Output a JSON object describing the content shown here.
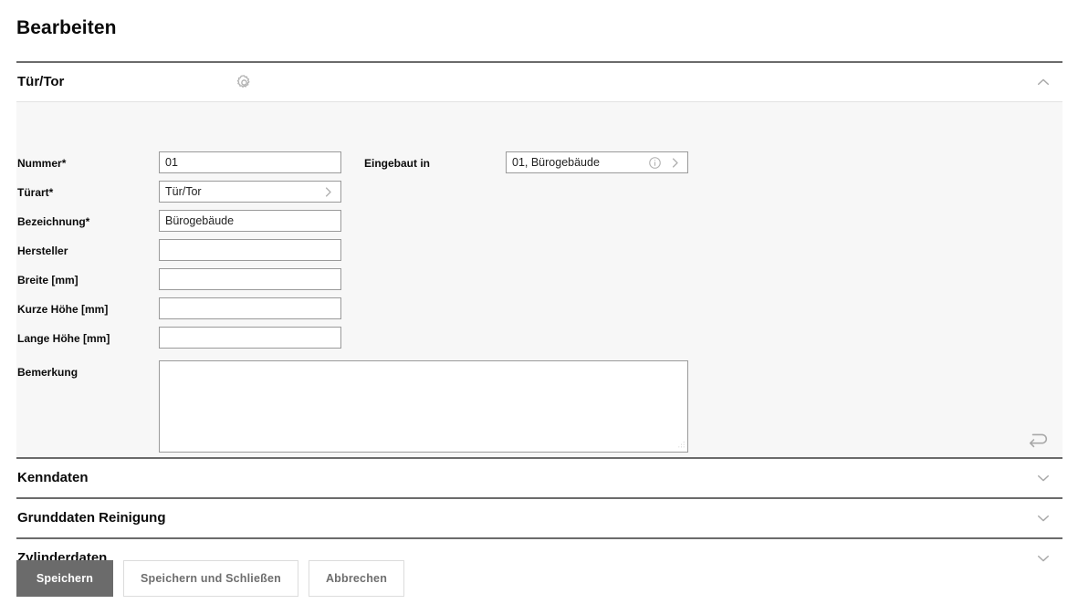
{
  "page": {
    "title": "Bearbeiten"
  },
  "sections": [
    {
      "title": "Tür/Tor",
      "expanded": true,
      "gear_icon": "gear-icon",
      "toggle_icon": "chevron-up-icon",
      "revert_icon": "undo-arrow-icon",
      "fields_left": [
        {
          "label": "Nummer",
          "required": true,
          "required_marker": "*",
          "value": "01",
          "placeholder": "",
          "type": "text",
          "trailing": []
        },
        {
          "label": "Türart",
          "required": true,
          "required_marker": "*",
          "value": "Tür/Tor",
          "placeholder": "",
          "type": "picker",
          "trailing": [
            "chevron-right-icon"
          ]
        },
        {
          "label": "Bezeichnung",
          "required": true,
          "required_marker": "*",
          "value": "Bürogebäude",
          "placeholder": "",
          "type": "text",
          "trailing": []
        },
        {
          "label": "Hersteller",
          "required": false,
          "required_marker": "",
          "value": "",
          "placeholder": "",
          "type": "text",
          "trailing": []
        },
        {
          "label": "Breite [mm]",
          "required": false,
          "required_marker": "",
          "value": "",
          "placeholder": "",
          "type": "text",
          "trailing": []
        },
        {
          "label": "Kurze Höhe [mm]",
          "required": false,
          "required_marker": "",
          "value": "",
          "placeholder": "",
          "type": "text",
          "trailing": []
        },
        {
          "label": "Lange Höhe [mm]",
          "required": false,
          "required_marker": "",
          "value": "",
          "placeholder": "",
          "type": "text",
          "trailing": []
        }
      ],
      "fields_right": [
        {
          "label": "Eingebaut in",
          "required": false,
          "required_marker": "",
          "value": "01, Bürogebäude",
          "placeholder": "",
          "type": "picker",
          "trailing": [
            "info-circle-icon",
            "chevron-right-icon"
          ]
        }
      ],
      "textarea_field": {
        "label": "Bemerkung",
        "required": false,
        "value": "",
        "placeholder": ""
      }
    },
    {
      "title": "Kenndaten",
      "expanded": false,
      "toggle_icon": "chevron-down-icon"
    },
    {
      "title": "Grunddaten Reinigung",
      "expanded": false,
      "toggle_icon": "chevron-down-icon"
    },
    {
      "title": "Zylinderdaten",
      "expanded": false,
      "toggle_icon": "chevron-down-icon"
    }
  ],
  "buttons": {
    "save": "Speichern",
    "save_and_close": "Speichern und Schließen",
    "cancel": "Abbrechen"
  },
  "colors": {
    "primary_button_bg": "#6b6b6b",
    "rule": "#6b6b6b",
    "panel_bg": "#f7f7f7",
    "input_border": "#9a9a9a",
    "icon_gray": "#aaaaaa",
    "secondary_button_border": "#dcdcdc",
    "secondary_button_text": "#6e6e6e"
  }
}
